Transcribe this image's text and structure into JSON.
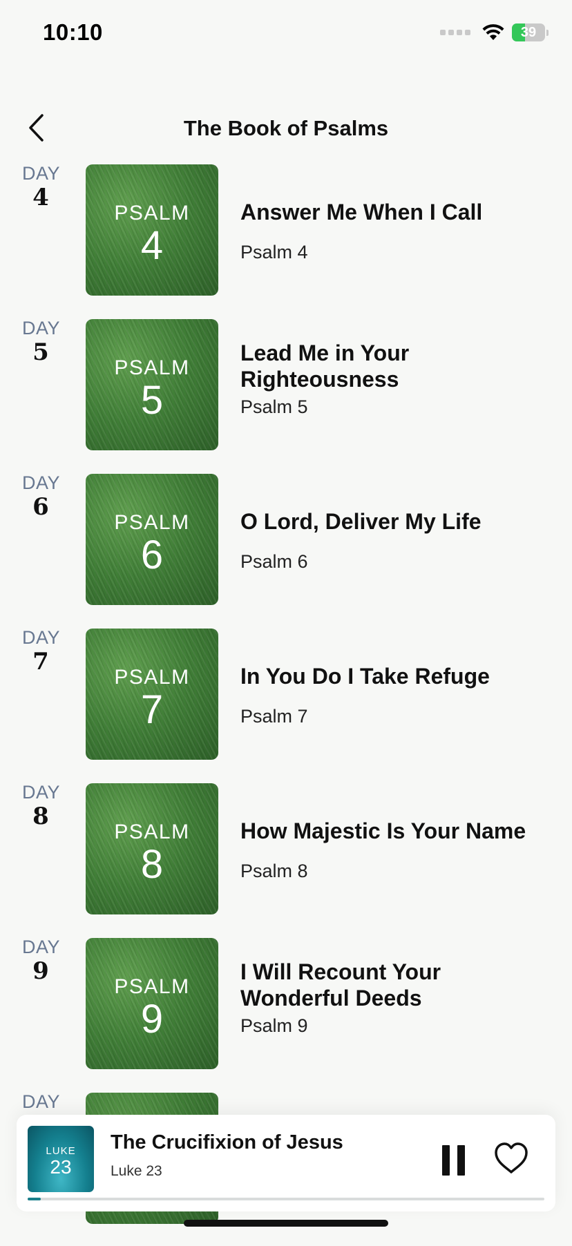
{
  "status_bar": {
    "time": "10:10",
    "battery_level": "39",
    "battery_fraction": 0.39
  },
  "nav": {
    "title": "The Book of Psalms",
    "back_icon": "chevron-left-icon"
  },
  "items": [
    {
      "day_label": "DAY",
      "day": "4",
      "thumb_label": "PSALM",
      "thumb_num": "4",
      "title": "Answer Me When I Call",
      "subtitle": "Psalm 4"
    },
    {
      "day_label": "DAY",
      "day": "5",
      "thumb_label": "PSALM",
      "thumb_num": "5",
      "title": "Lead Me in Your Righteousness",
      "subtitle": "Psalm 5"
    },
    {
      "day_label": "DAY",
      "day": "6",
      "thumb_label": "PSALM",
      "thumb_num": "6",
      "title": "O Lord, Deliver My Life",
      "subtitle": "Psalm 6"
    },
    {
      "day_label": "DAY",
      "day": "7",
      "thumb_label": "PSALM",
      "thumb_num": "7",
      "title": "In You Do I Take Refuge",
      "subtitle": "Psalm 7"
    },
    {
      "day_label": "DAY",
      "day": "8",
      "thumb_label": "PSALM",
      "thumb_num": "8",
      "title": "How Majestic Is Your Name",
      "subtitle": "Psalm 8"
    },
    {
      "day_label": "DAY",
      "day": "9",
      "thumb_label": "PSALM",
      "thumb_num": "9",
      "title": "I Will Recount Your Wonderful Deeds",
      "subtitle": "Psalm 9"
    },
    {
      "day_label": "DAY"
    }
  ],
  "player": {
    "art_label": "LUKE",
    "art_num": "23",
    "title": "The Crucifixion of Jesus",
    "subtitle": "Luke 23",
    "progress": 0.025,
    "accent_color": "#1a7f8b"
  }
}
